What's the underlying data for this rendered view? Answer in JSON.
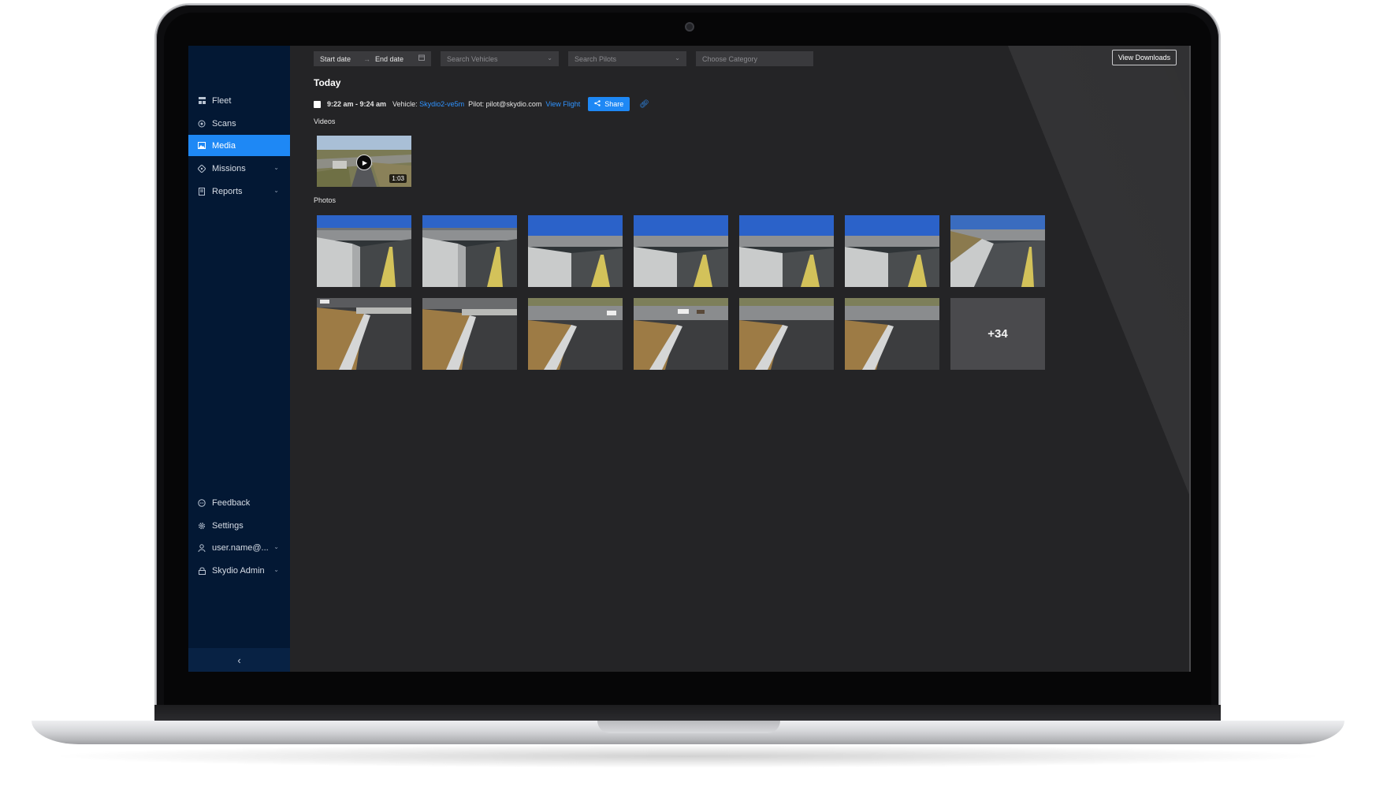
{
  "sidebar": {
    "items": [
      {
        "label": "Fleet",
        "icon": "fleet-icon"
      },
      {
        "label": "Scans",
        "icon": "scans-icon"
      },
      {
        "label": "Media",
        "icon": "media-icon",
        "active": true
      },
      {
        "label": "Missions",
        "icon": "missions-icon",
        "expandable": true
      },
      {
        "label": "Reports",
        "icon": "reports-icon",
        "expandable": true
      }
    ],
    "bottom_items": [
      {
        "label": "Feedback",
        "icon": "feedback-icon"
      },
      {
        "label": "Settings",
        "icon": "settings-icon"
      },
      {
        "label": "user.name@...",
        "icon": "user-icon",
        "expandable": true
      },
      {
        "label": "Skydio Admin",
        "icon": "lock-icon",
        "expandable": true
      }
    ],
    "collapse_glyph": "‹"
  },
  "filters": {
    "start_date": "Start date",
    "date_arrow": "→",
    "end_date": "End date",
    "vehicles_placeholder": "Search Vehicles",
    "pilots_placeholder": "Search Pilots",
    "category_placeholder": "Choose Category",
    "view_downloads": "View Downloads"
  },
  "day": {
    "title": "Today",
    "flight": {
      "time": "9:22 am - 9:24 am",
      "vehicle_label": "Vehicle:",
      "vehicle_value": "Skydio2-ve5m",
      "pilot_label": "Pilot:",
      "pilot_value": "pilot@skydio.com",
      "view_flight": "View Flight",
      "share": "Share"
    },
    "videos_label": "Videos",
    "video_duration": "1:03",
    "photos_label": "Photos",
    "more_count": "+34"
  },
  "colors": {
    "accent": "#1e88f5",
    "sidebar_bg": "#031834",
    "content_bg": "#242426",
    "link": "#2f93ff"
  }
}
